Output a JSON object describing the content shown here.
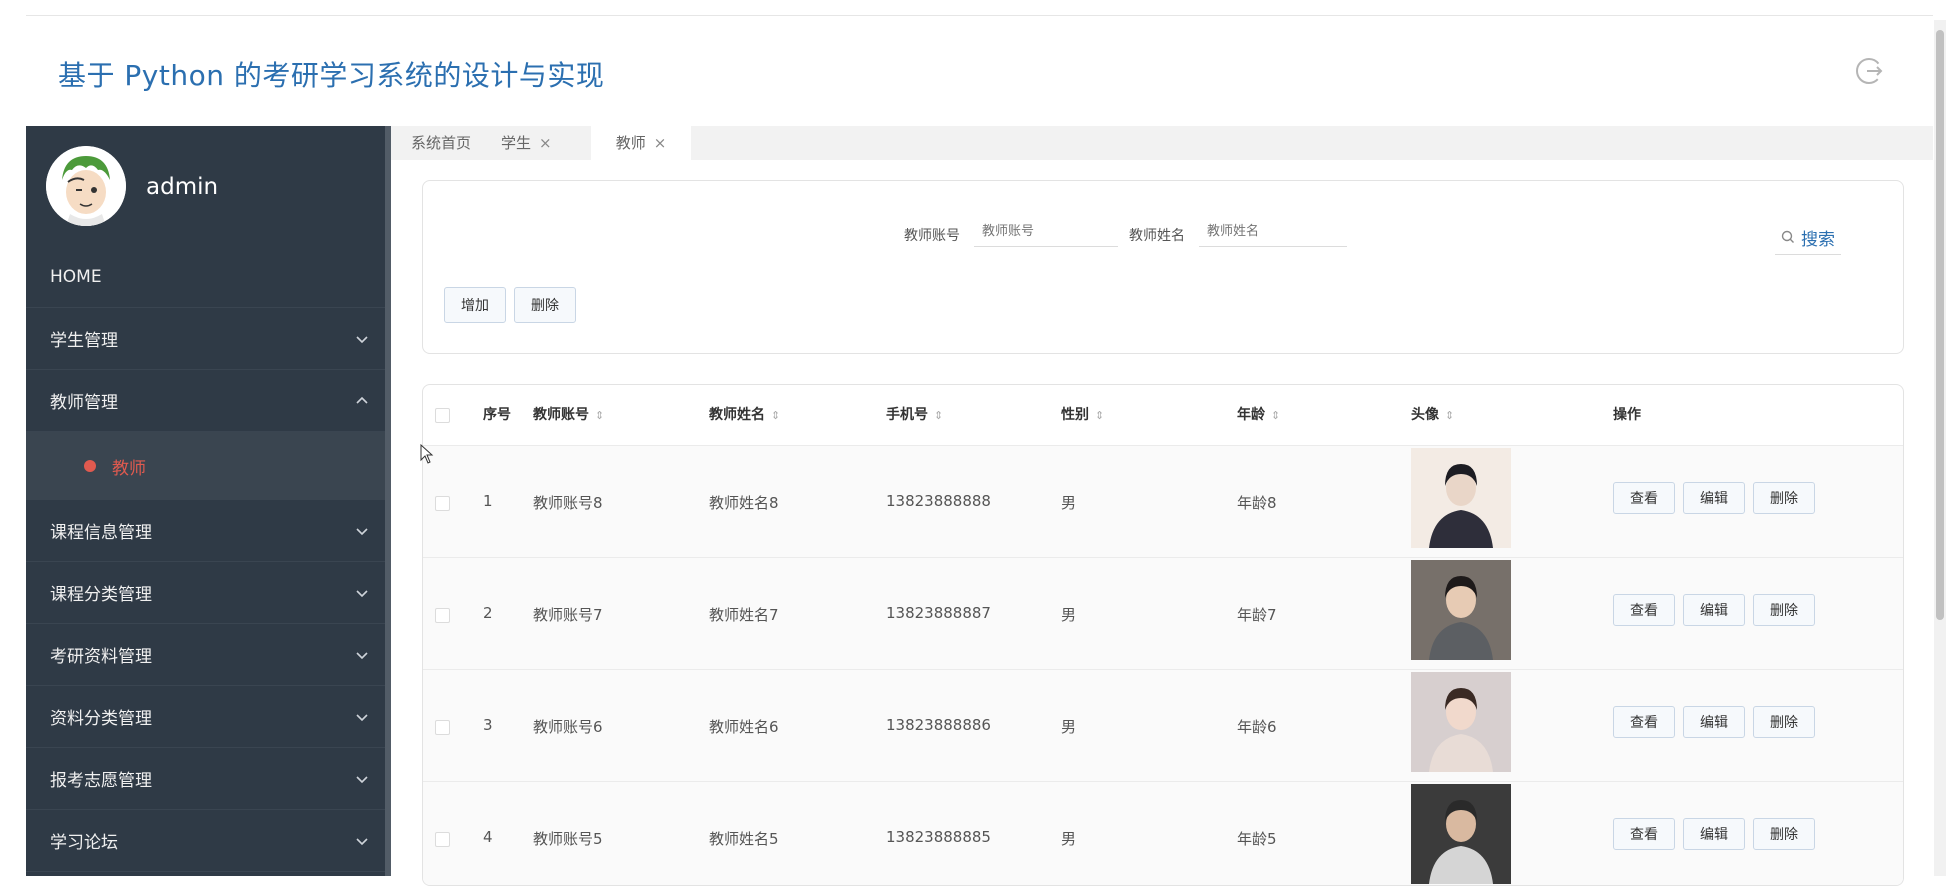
{
  "header": {
    "title": "基于 Python 的考研学习系统的设计与实现",
    "logout_icon": "logout-icon"
  },
  "user": {
    "name": "admin",
    "avatar_icon": "avatar-icon"
  },
  "menu": [
    {
      "label": "HOME",
      "has_chevron": false
    },
    {
      "label": "学生管理",
      "has_chevron": true,
      "expanded": false
    },
    {
      "label": "教师管理",
      "has_chevron": true,
      "expanded": true,
      "children": [
        {
          "label": "教师",
          "active": true
        }
      ]
    },
    {
      "label": "课程信息管理",
      "has_chevron": true,
      "expanded": false
    },
    {
      "label": "课程分类管理",
      "has_chevron": true,
      "expanded": false
    },
    {
      "label": "考研资料管理",
      "has_chevron": true,
      "expanded": false
    },
    {
      "label": "资料分类管理",
      "has_chevron": true,
      "expanded": false
    },
    {
      "label": "报考志愿管理",
      "has_chevron": true,
      "expanded": false
    },
    {
      "label": "学习论坛",
      "has_chevron": true,
      "expanded": false
    }
  ],
  "tabs": [
    {
      "label": "系统首页",
      "closable": false,
      "active": false
    },
    {
      "label": "学生",
      "closable": true,
      "active": false
    },
    {
      "label": "教师",
      "closable": true,
      "active": true
    }
  ],
  "search": {
    "account_label": "教师账号",
    "account_placeholder": "教师账号",
    "name_label": "教师姓名",
    "name_placeholder": "教师姓名",
    "button_label": "搜索"
  },
  "toolbar": {
    "add_label": "增加",
    "delete_label": "删除"
  },
  "table": {
    "headers": [
      "序号",
      "教师账号",
      "教师姓名",
      "手机号",
      "性别",
      "年龄",
      "头像",
      "操作"
    ],
    "sortable": [
      false,
      true,
      true,
      true,
      true,
      true,
      true,
      false
    ],
    "rows": [
      {
        "index": "1",
        "account": "教师账号8",
        "name": "教师姓名8",
        "phone": "13823888888",
        "gender": "男",
        "age": "年龄8"
      },
      {
        "index": "2",
        "account": "教师账号7",
        "name": "教师姓名7",
        "phone": "13823888887",
        "gender": "男",
        "age": "年龄7"
      },
      {
        "index": "3",
        "account": "教师账号6",
        "name": "教师姓名6",
        "phone": "13823888886",
        "gender": "男",
        "age": "年龄6"
      },
      {
        "index": "4",
        "account": "教师账号5",
        "name": "教师姓名5",
        "phone": "13823888885",
        "gender": "男",
        "age": "年龄5"
      }
    ],
    "actions": {
      "view": "查看",
      "edit": "编辑",
      "delete": "删除"
    }
  },
  "colors": {
    "title": "#2b6fb0",
    "sidebar_bg": "#2f3a46",
    "active_menu": "#e05a4f"
  }
}
